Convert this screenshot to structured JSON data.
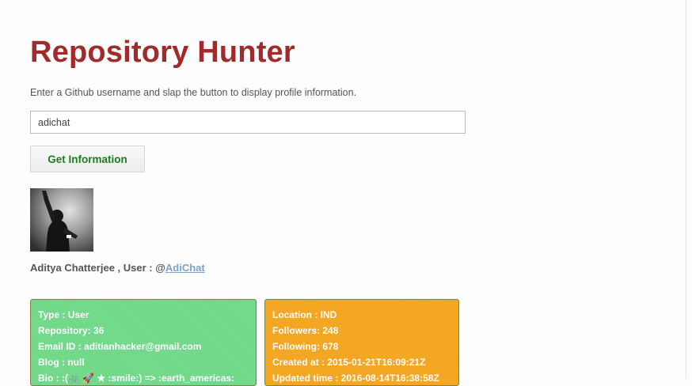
{
  "app": {
    "title": "Repository Hunter",
    "instructions": "Enter a Github username and slap the button to display profile information."
  },
  "search": {
    "value": "adichat",
    "button_label": "Get Information"
  },
  "profile": {
    "name_prefix": "Aditya Chatterjee , User : @",
    "username_link": "AdiChat",
    "avatar_icon": "profile-photo"
  },
  "cards": {
    "left": {
      "color": "#6fd888",
      "rows": [
        "Type : User",
        "Repository: 36",
        "Email ID : aditianhacker@gmail.com",
        "Blog : null",
        "Bio : :(🚲 🚀 ★ :smile:) => :earth_americas:"
      ]
    },
    "right": {
      "color": "#f3a51d",
      "rows": [
        "Location : IND",
        "Followers: 248",
        "Following: 678",
        "Created at : 2015-01-21T16:09:21Z",
        "Updated time : 2016-08-14T16:38:58Z"
      ]
    }
  },
  "colors": {
    "title": "#a12a2a",
    "button_text": "#1b7d1b",
    "link": "#7fa1c6"
  }
}
